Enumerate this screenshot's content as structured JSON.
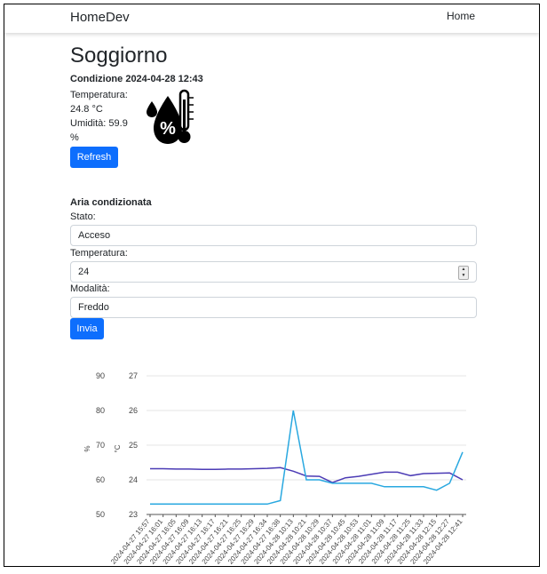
{
  "navbar": {
    "brand": "HomeDev",
    "home_link": "Home"
  },
  "page": {
    "title": "Soggiorno"
  },
  "condition": {
    "heading": "Condizione 2024-04-28 12:43",
    "temperature_label": "Temperatura:",
    "temperature_value": "24.8 °C",
    "humidity_label": "Umidità: 59.9",
    "humidity_unit": "%",
    "icon": "humidity-temperature-icon",
    "refresh_label": "Refresh"
  },
  "ac": {
    "title": "Aria condizionata",
    "state_label": "Stato:",
    "state_value": "Acceso",
    "temp_label": "Temperatura:",
    "temp_value": "24",
    "mode_label": "Modalità:",
    "mode_value": "Freddo",
    "submit_label": "Invia"
  },
  "colors": {
    "primary": "#0d6efd",
    "humidity_line": "#4b3bb5",
    "temperature_line": "#29a8e0"
  },
  "chart_data": {
    "type": "line",
    "left_axis": {
      "unit": "%",
      "ticks": [
        50,
        60,
        70,
        80,
        90
      ],
      "range": [
        50,
        90
      ]
    },
    "right_axis": {
      "unit": "°C",
      "ticks": [
        23,
        24,
        25,
        26,
        27
      ],
      "range": [
        23,
        27
      ]
    },
    "x": [
      "2024-04-27 15:57",
      "2024-04-27 16:01",
      "2024-04-27 16:05",
      "2024-04-27 16:09",
      "2024-04-27 16:13",
      "2024-04-27 16:17",
      "2024-04-27 16:21",
      "2024-04-27 16:25",
      "2024-04-27 16:29",
      "2024-04-27 16:34",
      "2024-04-27 16:38",
      "2024-04-28 10:13",
      "2024-04-28 10:21",
      "2024-04-28 10:29",
      "2024-04-28 10:37",
      "2024-04-28 10:45",
      "2024-04-28 10:53",
      "2024-04-28 11:01",
      "2024-04-28 11:09",
      "2024-04-28 11:17",
      "2024-04-28 11:25",
      "2024-04-28 11:33",
      "2024-04-28 12:15",
      "2024-04-28 12:27",
      "2024-04-28 12:41"
    ],
    "series": [
      {
        "axis": "left",
        "color": "#4b3bb5",
        "values": [
          63.2,
          63.2,
          63.1,
          63.1,
          63.0,
          63.0,
          63.1,
          63.1,
          63.2,
          63.3,
          63.5,
          62.5,
          61.1,
          61.0,
          59.2,
          60.6,
          61.0,
          61.6,
          62.2,
          62.2,
          61.2,
          61.8,
          61.9,
          62.0,
          60.0
        ]
      },
      {
        "axis": "right",
        "color": "#29a8e0",
        "values": [
          23.3,
          23.3,
          23.3,
          23.3,
          23.3,
          23.3,
          23.3,
          23.3,
          23.3,
          23.3,
          23.4,
          26.0,
          24.0,
          24.0,
          23.9,
          23.9,
          23.9,
          23.9,
          23.8,
          23.8,
          23.8,
          23.8,
          23.7,
          23.9,
          24.8
        ]
      }
    ]
  }
}
